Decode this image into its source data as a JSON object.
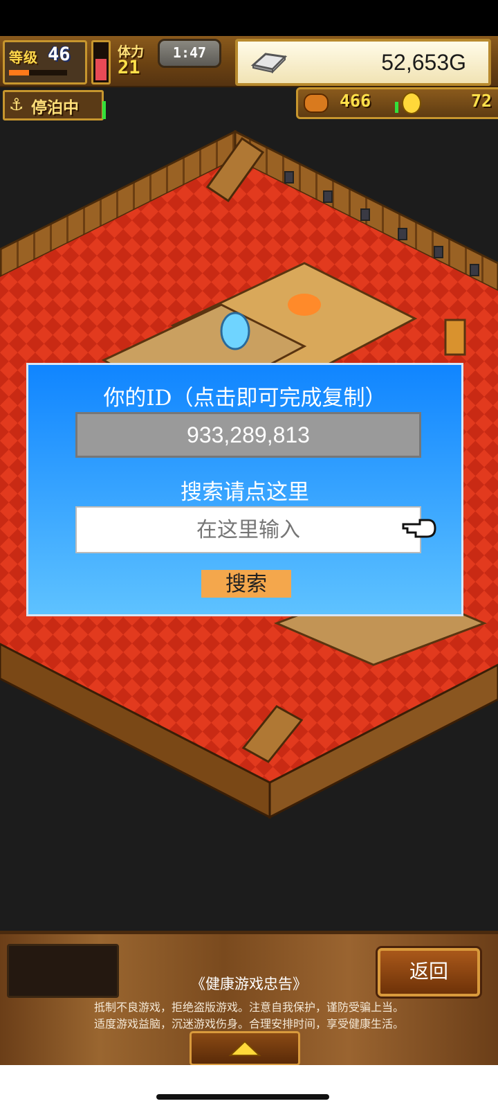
{
  "hud": {
    "level_label": "等级",
    "level_value": "46",
    "exp_progress": 0.35,
    "stamina_level": 0.6,
    "stamina_label": "体力",
    "stamina_value": "21",
    "timer": "1:47",
    "gold": "52,653G",
    "dock_status": "停泊中",
    "bread_count": "466",
    "medal_count": "72"
  },
  "dialog": {
    "title": "你的ID（点击即可完成复制）",
    "user_id": "933,289,813",
    "search_hint": "搜索请点这里",
    "search_placeholder": "在这里输入",
    "search_button": "搜索"
  },
  "bottom": {
    "back_button": "返回",
    "notice_title": "《健康游戏忠告》",
    "notice_line1": "抵制不良游戏，拒绝盗版游戏。注意自我保护，谨防受骗上当。",
    "notice_line2": "适度游戏益脑，沉迷游戏伤身。合理安排时间，享受健康生活。"
  },
  "colors": {
    "dialog_top": "#1085ff",
    "dialog_bottom": "#5ec2ff",
    "search_button": "#f4a74c",
    "deck_red": "#e23a1e"
  },
  "icons": [
    "anchor-icon",
    "silver-bar-icon",
    "bread-icon",
    "medal-icon",
    "pointer-hand-icon",
    "up-arrow-icon"
  ]
}
